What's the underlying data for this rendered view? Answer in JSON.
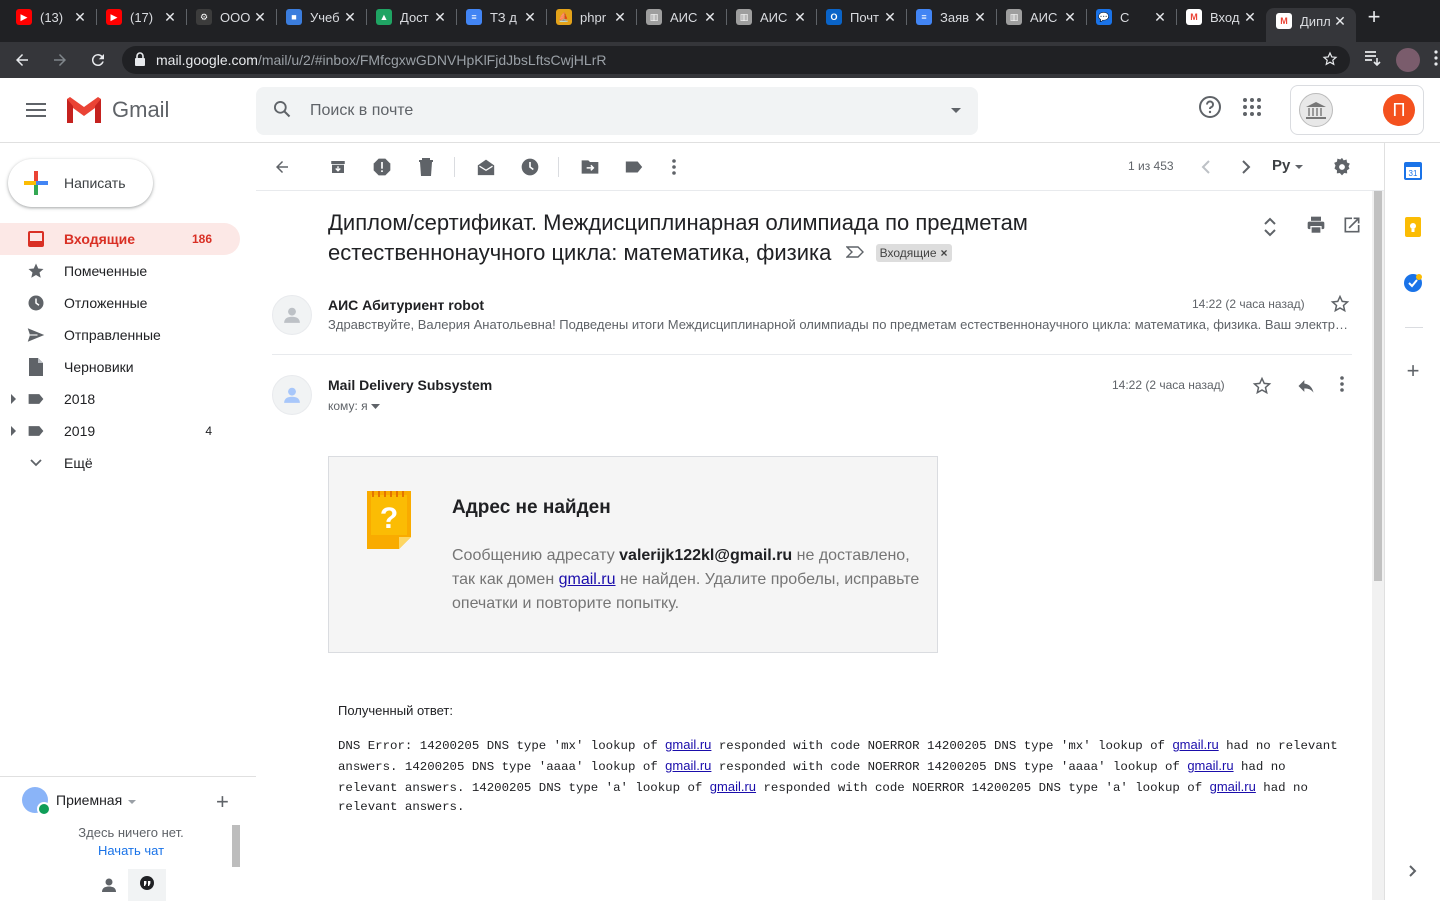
{
  "browser": {
    "tabs": [
      {
        "label": "(13)",
        "fav_color": "#ff0000",
        "fav_glyph": "▶"
      },
      {
        "label": "(17)",
        "fav_color": "#ff0000",
        "fav_glyph": "▶"
      },
      {
        "label": "ООО",
        "fav_color": "#3c3c3c",
        "fav_glyph": "⚙"
      },
      {
        "label": "Учеб",
        "fav_color": "#3b7ddd",
        "fav_glyph": "■"
      },
      {
        "label": "Дост",
        "fav_color": "#1fa463",
        "fav_glyph": "▲"
      },
      {
        "label": "ТЗ д",
        "fav_color": "#4285f4",
        "fav_glyph": "≡"
      },
      {
        "label": "phpr",
        "fav_color": "#e3a21a",
        "fav_glyph": "⛵"
      },
      {
        "label": "АИС",
        "fav_color": "#9e9e9e",
        "fav_glyph": "▥"
      },
      {
        "label": "АИС",
        "fav_color": "#9e9e9e",
        "fav_glyph": "▥"
      },
      {
        "label": "Почт",
        "fav_color": "#0a64c8",
        "fav_glyph": "O"
      },
      {
        "label": "Заяв",
        "fav_color": "#4285f4",
        "fav_glyph": "≡"
      },
      {
        "label": "АИС",
        "fav_color": "#9e9e9e",
        "fav_glyph": "▥"
      },
      {
        "label": "С",
        "fav_color": "#1a73e8",
        "fav_glyph": "💬"
      },
      {
        "label": "Вход",
        "fav_color": "#ffffff",
        "fav_glyph": "M"
      },
      {
        "label": "Дипл",
        "fav_color": "#ffffff",
        "fav_glyph": "M"
      }
    ],
    "url_host": "mail.google.com",
    "url_path": "/mail/u/2/#inbox/FMfcgxwGDNVHpKlFjdJbsLftsCwjHLrR"
  },
  "header": {
    "app_name": "Gmail",
    "search_placeholder": "Поиск в почте",
    "account_initial": "П"
  },
  "sidebar": {
    "compose_label": "Написать",
    "items": [
      {
        "label": "Входящие",
        "count": "186",
        "icon": "inbox-icon"
      },
      {
        "label": "Помеченные",
        "count": "",
        "icon": "star-icon"
      },
      {
        "label": "Отложенные",
        "count": "",
        "icon": "clock-icon"
      },
      {
        "label": "Отправленные",
        "count": "",
        "icon": "send-icon"
      },
      {
        "label": "Черновики",
        "count": "",
        "icon": "draft-icon"
      },
      {
        "label": "2018",
        "count": "",
        "icon": "label-icon"
      },
      {
        "label": "2019",
        "count": "4",
        "icon": "label-icon"
      },
      {
        "label": "Ещё",
        "count": "",
        "icon": "chevron-down-icon"
      }
    ],
    "hangouts": {
      "user": "Приемная",
      "empty_text": "Здесь ничего нет.",
      "start_chat": "Начать чат"
    }
  },
  "toolbar": {
    "pager": "1 из 453",
    "language": "Ру"
  },
  "thread": {
    "subject": "Диплом/сертификат. Междисциплинарная олимпиада по предметам естественнонаучного цикла: математика, физика",
    "label": "Входящие",
    "messages": [
      {
        "sender": "АИС Абитуриент robot",
        "time": "14:22 (2 часа назад)",
        "snippet": "Здравствуйте, Валерия Анатольевна! Подведены итоги Междисциплинарной олимпиады по предметам естественнонаучного цикла: математика, физика. Ваш электронный диплом/сертификат доступен в личном кабинете."
      },
      {
        "sender": "Mail Delivery Subsystem",
        "time": "14:22 (2 часа назад)",
        "to": "кому: я"
      }
    ],
    "bounce": {
      "title": "Адрес не найден",
      "text_before": "Сообщению адресату ",
      "address": "valerijk122kl@gmail.ru",
      "text_middle": " не доставлено, так как домен ",
      "domain": "gmail.ru",
      "text_after": " не найден. Удалите пробелы, исправьте опечатки и повторите попытку."
    },
    "received_label": "Полученный ответ:",
    "dns_error": [
      {
        "t": "DNS Error: 14200205 DNS type 'mx' lookup of "
      },
      {
        "link": "gmail.ru"
      },
      {
        "t": " responded with code NOERROR 14200205 DNS type 'mx' lookup of "
      },
      {
        "link": "gmail.ru"
      },
      {
        "t": " had no relevant answers. 14200205 DNS type 'aaaa' lookup of "
      },
      {
        "link": "gmail.ru"
      },
      {
        "t": " responded with code NOERROR 14200205 DNS type 'aaaa' lookup of "
      },
      {
        "link": "gmail.ru"
      },
      {
        "t": " had no relevant answers. 14200205 DNS type 'a' lookup of "
      },
      {
        "link": "gmail.ru"
      },
      {
        "t": " responded with code NOERROR 14200205 DNS type 'a' lookup of "
      },
      {
        "link": "gmail.ru"
      },
      {
        "t": " had no relevant answers."
      }
    ]
  },
  "side_panel": {
    "calendar_day": "31"
  },
  "colors": {
    "accent_red": "#d93025",
    "active_bg": "#fce8e6",
    "link": "#1a0dab"
  }
}
